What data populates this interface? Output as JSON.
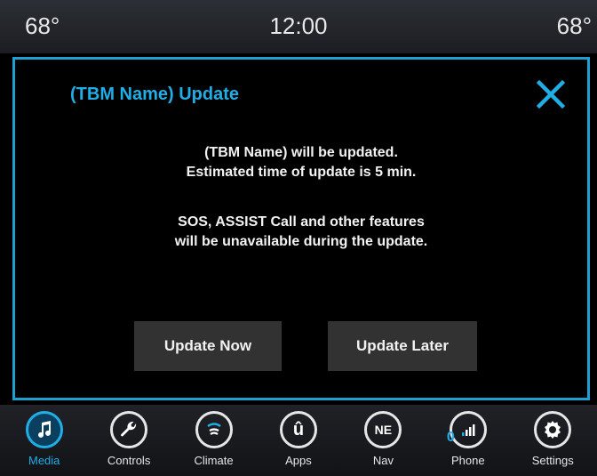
{
  "status_bar": {
    "temp_left": "68°",
    "clock": "12:00",
    "temp_right": "68°"
  },
  "dialog": {
    "title": "(TBM Name) Update",
    "close_icon": "close-icon",
    "message_line_1": "(TBM Name) will be updated.",
    "message_line_2": "Estimated time of update is 5 min.",
    "message_line_3": "SOS, ASSIST Call and other features",
    "message_line_4": "will be unavailable during the update.",
    "update_now_label": "Update Now",
    "update_later_label": "Update Later"
  },
  "nav": {
    "items": [
      {
        "label": "Media",
        "icon": "music-note-icon",
        "active": true
      },
      {
        "label": "Controls",
        "icon": "wrench-icon",
        "active": false
      },
      {
        "label": "Climate",
        "icon": "climate-icon",
        "active": false
      },
      {
        "label": "Apps",
        "icon": "apps-icon",
        "active": false
      },
      {
        "label": "Nav",
        "icon": "compass-icon",
        "active": false
      },
      {
        "label": "Phone",
        "icon": "phone-signal-icon",
        "active": false
      },
      {
        "label": "Settings",
        "icon": "gear-icon",
        "active": false
      }
    ],
    "nav_compass_text": "NE",
    "apps_glyph": "û",
    "phone_badge": "0"
  },
  "colors": {
    "accent": "#1faee6",
    "dialog_border": "#1f9fd0",
    "button_bg": "#323232"
  }
}
